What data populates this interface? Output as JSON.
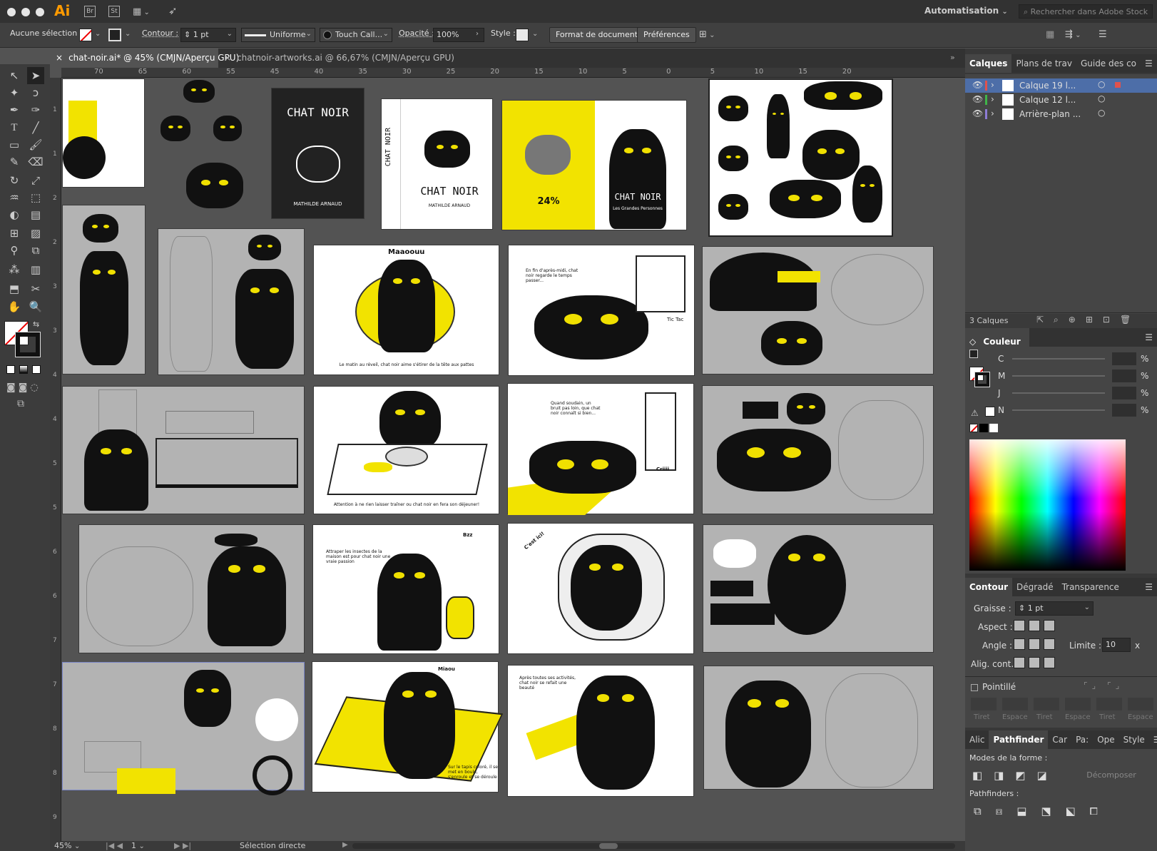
{
  "titlebar": {
    "app_logo": "Ai",
    "bridge": "Br",
    "stock": "St",
    "workspace": "Automatisation",
    "search_placeholder": "Rechercher dans Adobe Stock"
  },
  "control": {
    "selection": "Aucune sélection",
    "contour_label": "Contour :",
    "stroke_weight": "1 pt",
    "stroke_profile": "Uniforme",
    "brush": "Touch Call...",
    "opacity_label": "Opacité :",
    "opacity_value": "100%",
    "style_label": "Style :",
    "doc_format": "Format de document",
    "preferences": "Préférences"
  },
  "tabs": [
    {
      "label": "chat-noir.ai* @ 45% (CMJN/Aperçu GPU)",
      "close": "×"
    },
    {
      "label": "chatnoir-artworks.ai @ 66,67% (CMJN/Aperçu GPU)",
      "close": "×"
    }
  ],
  "ruler_h": [
    "70",
    "65",
    "60",
    "55",
    "45",
    "40",
    "35",
    "30",
    "25",
    "20",
    "15",
    "10",
    "5",
    "0",
    "5",
    "10",
    "15",
    "20"
  ],
  "ruler_v": [
    "1",
    "1",
    "2",
    "2",
    "3",
    "3",
    "4",
    "4",
    "5",
    "5",
    "6",
    "6",
    "7",
    "7",
    "8",
    "8",
    "9"
  ],
  "artboards": {
    "cover_title": "CHAT NOIR",
    "cover_author": "MATHILDE ARNAUD",
    "spine_title": "CHAT NOIR",
    "back_percent": "24%",
    "back_publisher": "Les Grandes Personnes",
    "p1_sound": "Maaoouu",
    "p1_caption": "Le matin au réveil, chat noir aime s'étirer de la tête aux pattes",
    "p2_caption": "En fin d'après-midi, chat noir regarde le temps passer...",
    "p2_tic": "Tic Tac",
    "p3_caption": "Attention à ne rien laisser traîner ou chat noir en fera son déjeuner!",
    "p4_caption": "Quand soudain, un bruit pas loin, que chat noir connaît si bien...",
    "p4_sound": "Criiii",
    "p5_caption": "Attraper les insectes de la maison est pour chat noir une vraie passion",
    "p5_sound": "Bzz",
    "p6_sound": "C'est ici!",
    "p7_caption": "Sur le tapis coloré, il se met en boule, s'enroule et se déroule",
    "p7_sound": "Miaou",
    "p8_caption": "Après toutes ses activités, chat noir se refait une beauté"
  },
  "status": {
    "zoom": "45%",
    "page": "1",
    "tool": "Sélection directe"
  },
  "layers": {
    "tabs": [
      "Calques",
      "Plans de trav",
      "Guide des co"
    ],
    "items": [
      {
        "name": "Calque 19 l...",
        "color": "#e0524d"
      },
      {
        "name": "Calque 12 l...",
        "color": "#3fb54a"
      },
      {
        "name": "Arrière-plan ...",
        "color": "#8d7cd6"
      }
    ],
    "count": "3 Calques"
  },
  "color_panel": {
    "title": "Couleur",
    "channels": [
      "C",
      "M",
      "J",
      "N"
    ],
    "pct": "%"
  },
  "stroke_panel": {
    "tabs": [
      "Contour",
      "Dégradé",
      "Transparence"
    ],
    "graisse_label": "Graisse :",
    "graisse_value": "1 pt",
    "aspect_label": "Aspect :",
    "angle_label": "Angle :",
    "limite_label": "Limite :",
    "limite_value": "10",
    "limite_x": "x",
    "align_label": "Alig. cont. :",
    "dashed_label": "Pointillé",
    "dash_cols": [
      "Tiret",
      "Espace",
      "Tiret",
      "Espace",
      "Tiret",
      "Espace"
    ]
  },
  "pathfinder": {
    "tabs": [
      "Alic",
      "Pathfinder",
      "Car",
      "Pa:",
      "Ope",
      "Style"
    ],
    "modes_label": "Modes de la forme :",
    "decompose": "Décomposer",
    "pathfinders_label": "Pathfinders :"
  },
  "colors": {
    "yellow": "#f2e300",
    "black": "#111111",
    "accent": "#4d7dbf"
  }
}
